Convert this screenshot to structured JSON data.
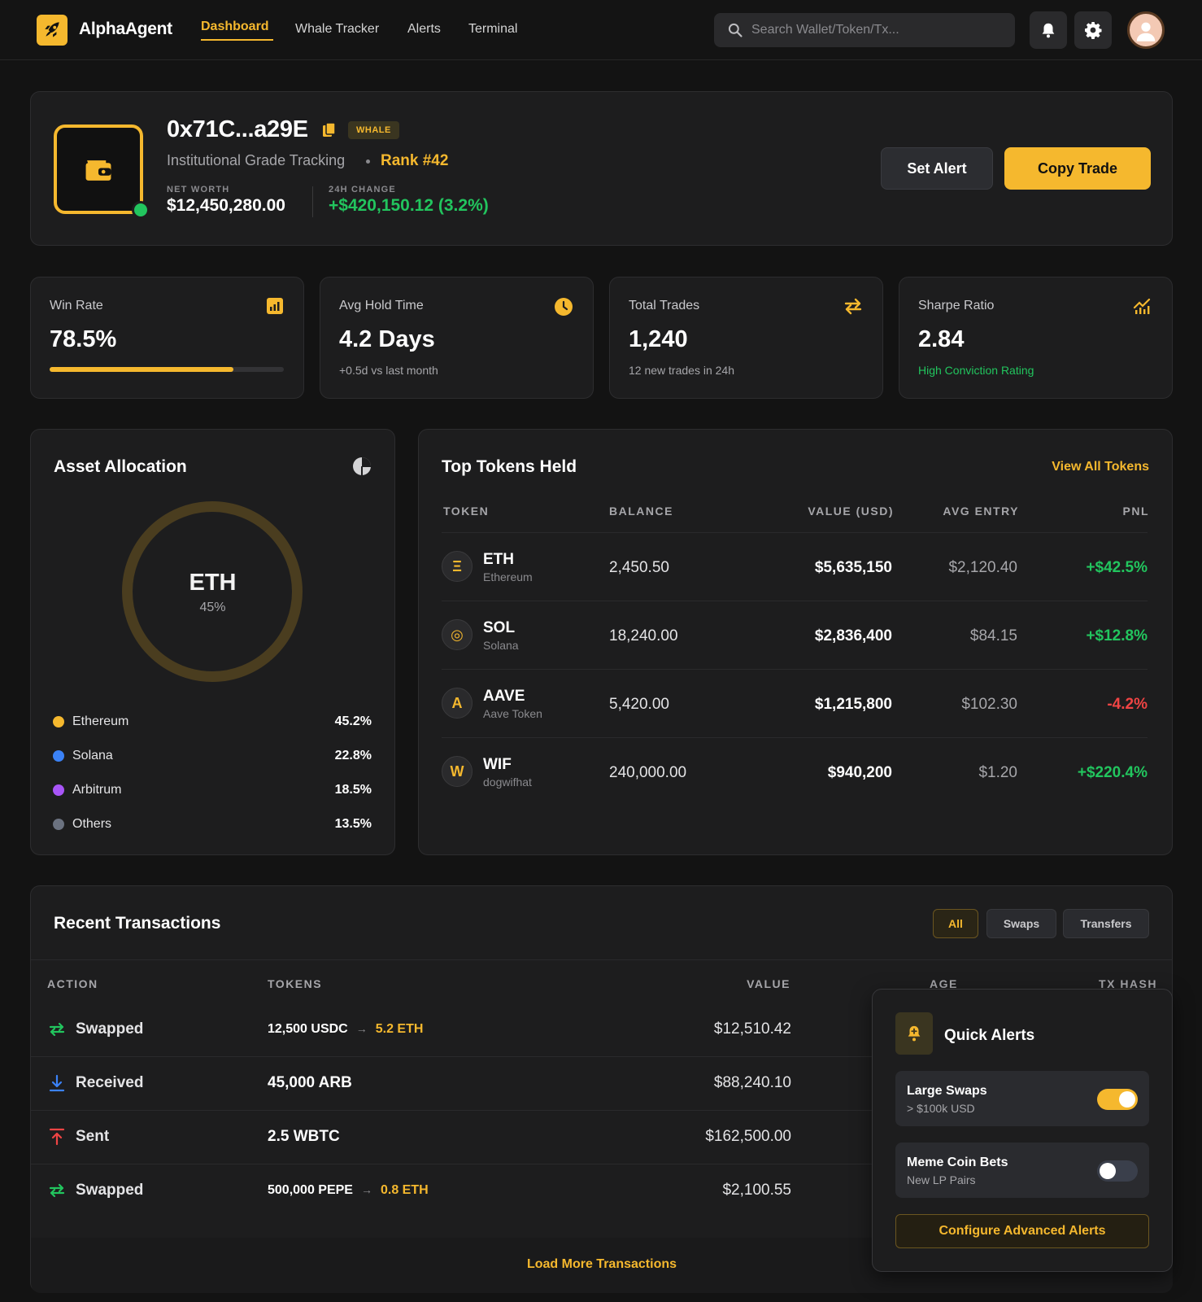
{
  "app": {
    "name": "AlphaAgent"
  },
  "nav": {
    "items": [
      "Dashboard",
      "Whale Tracker",
      "Alerts",
      "Terminal"
    ]
  },
  "search": {
    "placeholder": "Search Wallet/Token/Tx..."
  },
  "profile": {
    "address": "0x71C...a29E",
    "badge": "WHALE",
    "subtitle": "Institutional Grade Tracking",
    "rank": "Rank #42",
    "net_worth_label": "NET WORTH",
    "net_worth": "$12,450,280.00",
    "change_label": "24H CHANGE",
    "change": "+$420,150.12 (3.2%)",
    "set_alert": "Set Alert",
    "copy_trade": "Copy Trade"
  },
  "stats": [
    {
      "label": "Win Rate",
      "value": "78.5%",
      "progress": 0.785,
      "icon": "bar-chart-icon"
    },
    {
      "label": "Avg Hold Time",
      "value": "4.2 Days",
      "sub": "+0.5d vs last month",
      "icon": "clock-icon"
    },
    {
      "label": "Total Trades",
      "value": "1,240",
      "sub": "12 new trades in 24h",
      "icon": "swap-arrows-icon"
    },
    {
      "label": "Sharpe Ratio",
      "value": "2.84",
      "sub": "High Conviction Rating",
      "icon": "trend-chart-icon"
    }
  ],
  "allocation": {
    "title": "Asset Allocation",
    "center_label": "ETH",
    "center_pct": "45%",
    "items": [
      {
        "name": "Ethereum",
        "value": "45.2%",
        "color": "#f5b82e"
      },
      {
        "name": "Solana",
        "value": "22.8%",
        "color": "#3b82f6"
      },
      {
        "name": "Arbitrum",
        "value": "18.5%",
        "color": "#a855f7"
      },
      {
        "name": "Others",
        "value": "13.5%",
        "color": "#6b7280"
      }
    ]
  },
  "tokens": {
    "title": "Top Tokens Held",
    "view_all": "View All Tokens",
    "headers": [
      "TOKEN",
      "BALANCE",
      "VALUE (USD)",
      "AVG ENTRY",
      "PNL"
    ],
    "rows": [
      {
        "glyph": "Ξ",
        "symbol": "ETH",
        "name": "Ethereum",
        "balance": "2,450.50",
        "value": "$5,635,150",
        "avg": "$2,120.40",
        "pnl": "+$42.5%",
        "pnl_sign": "pos"
      },
      {
        "glyph": "◎",
        "symbol": "SOL",
        "name": "Solana",
        "balance": "18,240.00",
        "value": "$2,836,400",
        "avg": "$84.15",
        "pnl": "+$12.8%",
        "pnl_sign": "pos"
      },
      {
        "glyph": "A",
        "symbol": "AAVE",
        "name": "Aave Token",
        "balance": "5,420.00",
        "value": "$1,215,800",
        "avg": "$102.30",
        "pnl": "-4.2%",
        "pnl_sign": "neg"
      },
      {
        "glyph": "W",
        "symbol": "WIF",
        "name": "dogwifhat",
        "balance": "240,000.00",
        "value": "$940,200",
        "avg": "$1.20",
        "pnl": "+$220.4%",
        "pnl_sign": "pos"
      }
    ]
  },
  "transactions": {
    "title": "Recent Transactions",
    "filters": [
      "All",
      "Swaps",
      "Transfers"
    ],
    "headers": [
      "ACTION",
      "TOKENS",
      "VALUE",
      "AGE",
      "TX HASH"
    ],
    "rows": [
      {
        "action": "Swapped",
        "from": "12,500 USDC",
        "to": "5.2 ETH",
        "value": "$12,510.42",
        "icon": "swap-icon"
      },
      {
        "action": "Received",
        "from": "45,000 ARB",
        "to": "",
        "value": "$88,240.10",
        "icon": "download-icon"
      },
      {
        "action": "Sent",
        "from": "2.5 WBTC",
        "to": "",
        "value": "$162,500.00",
        "icon": "upload-icon"
      },
      {
        "action": "Swapped",
        "from": "500,000 PEPE",
        "to": "0.8 ETH",
        "value": "$2,100.55",
        "icon": "swap-icon"
      }
    ],
    "load_more": "Load More Transactions"
  },
  "quick_alerts": {
    "title": "Quick Alerts",
    "items": [
      {
        "name": "Large Swaps",
        "desc": "> $100k USD",
        "enabled": true
      },
      {
        "name": "Meme Coin Bets",
        "desc": "New LP Pairs",
        "enabled": false
      }
    ],
    "configure": "Configure Advanced Alerts"
  },
  "colors": {
    "accent": "#f5b82e",
    "positive": "#22c55e",
    "negative": "#ef4444",
    "background": "#131313",
    "card": "#1d1d1e"
  }
}
